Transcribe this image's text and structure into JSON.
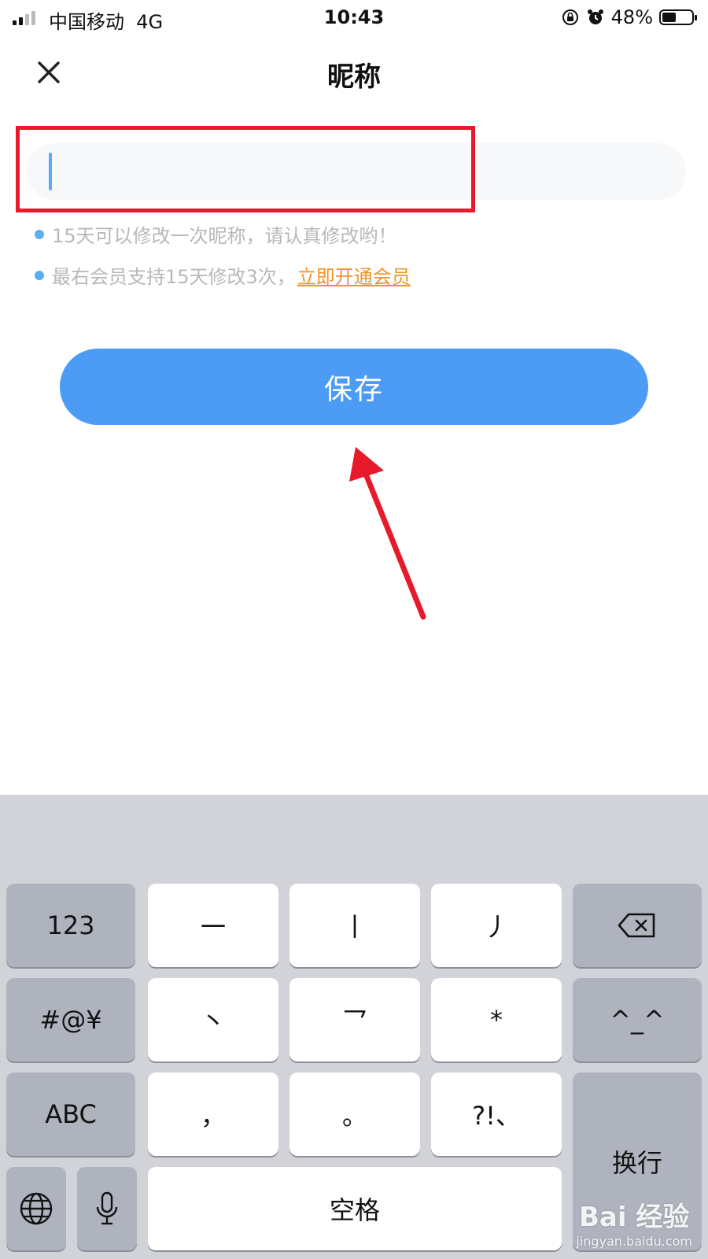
{
  "status_bar": {
    "carrier": "中国移动",
    "network": "4G",
    "time": "10:43",
    "battery": "48%",
    "battery_level": 0.48
  },
  "header": {
    "title": "昵称",
    "close_icon": "close-icon"
  },
  "nickname_input": {
    "value": "",
    "placeholder": ""
  },
  "tips": {
    "tip1": "15天可以修改一次昵称，请认真修改哟！",
    "tip2_text": "最右会员支持15天修改3次，",
    "tip2_link": "立即开通会员"
  },
  "save_button": {
    "label": "保存"
  },
  "keyboard": {
    "key_123": "123",
    "key_symbols": "#@¥",
    "key_abc": "ABC",
    "key_heng": "一",
    "key_shu": "丨",
    "key_pie": "丿",
    "key_dian": "丶",
    "key_zhe": "乛",
    "key_star": "*",
    "key_comma": "，",
    "key_period": "。",
    "key_punct": "?!、",
    "key_emoticon": "^_^",
    "key_space": "空格",
    "key_return": "换行"
  },
  "watermark": {
    "brand": "Bai 经验",
    "url": "jingyan.baidu.com"
  },
  "colors": {
    "accent": "#4c9bf5",
    "link": "#f0932b",
    "annotation": "#e61a2b"
  }
}
